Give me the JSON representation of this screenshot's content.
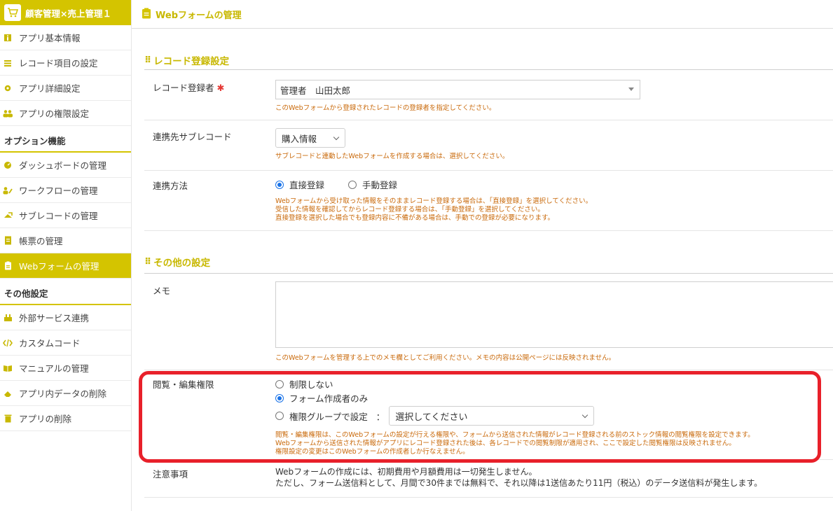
{
  "app": {
    "title": "顧客管理×売上管理１"
  },
  "sidebar": {
    "items": [
      {
        "label": "アプリ基本情報",
        "icon": "info-icon"
      },
      {
        "label": "レコード項目の設定",
        "icon": "list-icon"
      },
      {
        "label": "アプリ詳細設定",
        "icon": "gear-icon"
      },
      {
        "label": "アプリの権限設定",
        "icon": "users-icon"
      }
    ],
    "section_options": "オプション機能",
    "options": [
      {
        "label": "ダッシュボードの管理",
        "icon": "dashboard-icon"
      },
      {
        "label": "ワークフローの管理",
        "icon": "workflow-icon"
      },
      {
        "label": "サブレコードの管理",
        "icon": "subrecord-icon"
      },
      {
        "label": "帳票の管理",
        "icon": "document-icon"
      },
      {
        "label": "Webフォームの管理",
        "icon": "clipboard-icon"
      }
    ],
    "section_other": "その他設定",
    "other": [
      {
        "label": "外部サービス連携",
        "icon": "plugin-icon"
      },
      {
        "label": "カスタムコード",
        "icon": "code-icon"
      },
      {
        "label": "マニュアルの管理",
        "icon": "book-icon"
      },
      {
        "label": "アプリ内データの削除",
        "icon": "eraser-icon"
      },
      {
        "label": "アプリの削除",
        "icon": "trash-icon"
      }
    ]
  },
  "header": {
    "title": "Webフォームの管理"
  },
  "record_section": {
    "title": "レコード登録設定",
    "registrant": {
      "label": "レコード登録者",
      "required_mark": "✱",
      "value": "管理者　山田太郎",
      "hint": "このWebフォームから登録されたレコードの登録者を指定してください。"
    },
    "subrecord": {
      "label": "連携先サブレコード",
      "value": "購入情報",
      "hint": "サブレコードと連動したWebフォームを作成する場合は、選択してください。"
    },
    "method": {
      "label": "連携方法",
      "option_direct": "直接登録",
      "option_manual": "手動登録",
      "hint_1": "Webフォームから受け取った情報をそのままレコード登録する場合は、「直接登録」を選択してください。",
      "hint_2": "受信した情報を確認してからレコード登録する場合は、「手動登録」を選択してください。",
      "hint_3": "直接登録を選択した場合でも登録内容に不備がある場合は、手動での登録が必要になります。"
    }
  },
  "other_section": {
    "title": "その他の設定",
    "memo": {
      "label": "メモ",
      "hint": "このWebフォームを管理する上でのメモ欄としてご利用ください。メモの内容は公開ページには反映されません。"
    },
    "permission": {
      "label": "閲覧・編集権限",
      "option_none": "制限しない",
      "option_creator": "フォーム作成者のみ",
      "option_group": "権限グループで設定",
      "colon": "：",
      "group_placeholder": "選択してください",
      "hint_1": "閲覧・編集権限は、このWebフォームの設定が行える権限や、フォームから送信された情報がレコード登録される前のストック情報の閲覧権限を設定できます。",
      "hint_2": "Webフォームから送信された情報がアプリにレコード登録された後は、各レコードでの閲覧制限が適用され、ここで設定した閲覧権限は反映されません。",
      "hint_3": "権限設定の変更はこのWebフォームの作成者しか行なえません。"
    },
    "notes": {
      "label": "注意事項",
      "line_1": "Webフォームの作成には、初期費用や月額費用は一切発生しません。",
      "line_2": "ただし、フォーム送信料として、月間で30件までは無料で、それ以降は1送信あたり11円（税込）のデータ送信料が発生します。"
    }
  },
  "colors": {
    "accent": "#d4c400",
    "hint": "#c9690a",
    "highlight": "#e8202a",
    "radio": "#1a73e8"
  }
}
